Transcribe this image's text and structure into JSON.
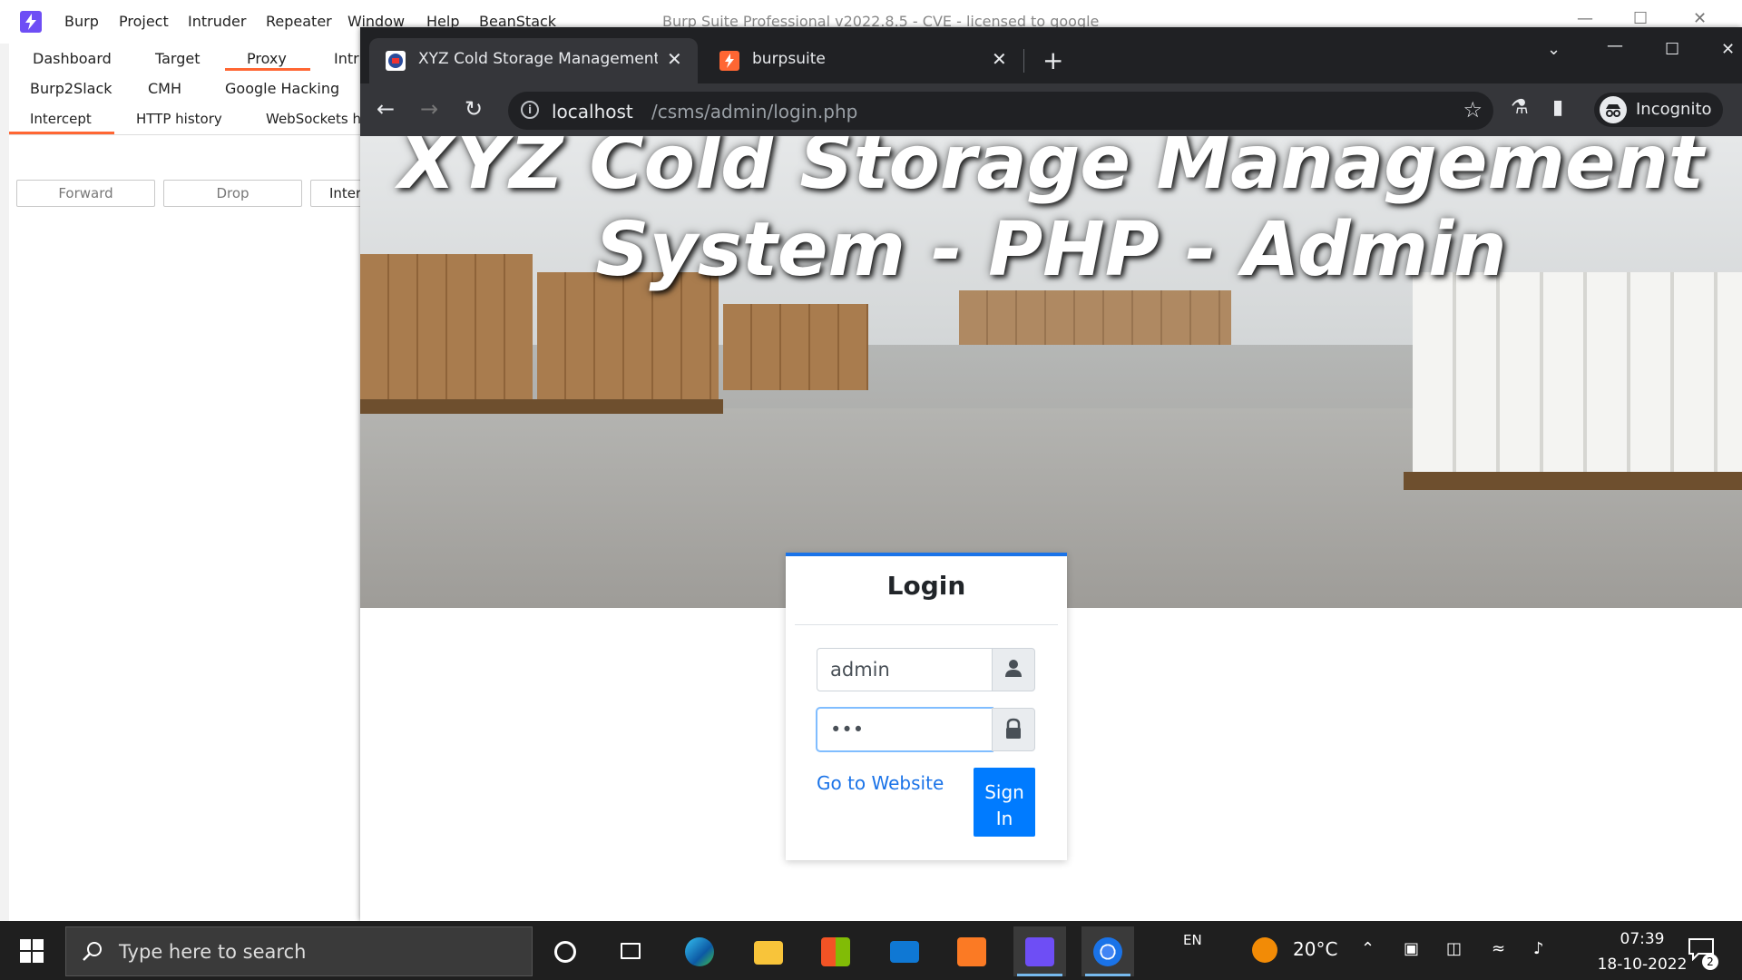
{
  "burp": {
    "menu": [
      "Burp",
      "Project",
      "Intruder",
      "Repeater",
      "Window",
      "Help",
      "BeanStack"
    ],
    "title": "Burp Suite Professional v2022.8.5 - CVE - licensed to google",
    "tabs_row1": [
      "Dashboard",
      "Target",
      "Proxy",
      "Intr"
    ],
    "tabs_row2": [
      "Burp2Slack",
      "CMH",
      "Google Hacking"
    ],
    "proxy_subtabs": [
      "Intercept",
      "HTTP history",
      "WebSockets h"
    ],
    "buttons": [
      "Forward",
      "Drop",
      "Inter"
    ],
    "accent": "#ff6633"
  },
  "chrome": {
    "tabs": [
      {
        "title": "XYZ Cold Storage Management S",
        "favicon": "site-favicon",
        "active": true
      },
      {
        "title": "burpsuite",
        "favicon": "burp-favicon",
        "active": false
      }
    ],
    "url_host": "localhost",
    "url_path": "/csms/admin/login.php",
    "incognito_label": "Incognito"
  },
  "page": {
    "hero_title": "XYZ Cold Storage Management System - PHP - Admin",
    "login": {
      "title": "Login",
      "username_value": "admin",
      "password_value": "•••",
      "go_to_website": "Go to Website",
      "sign_in": "Sign In",
      "accent": "#007bff"
    }
  },
  "taskbar": {
    "search_placeholder": "Type here to search",
    "language": "EN",
    "temperature": "20°C",
    "time": "07:39",
    "date": "18-10-2022",
    "notification_count": "2"
  }
}
